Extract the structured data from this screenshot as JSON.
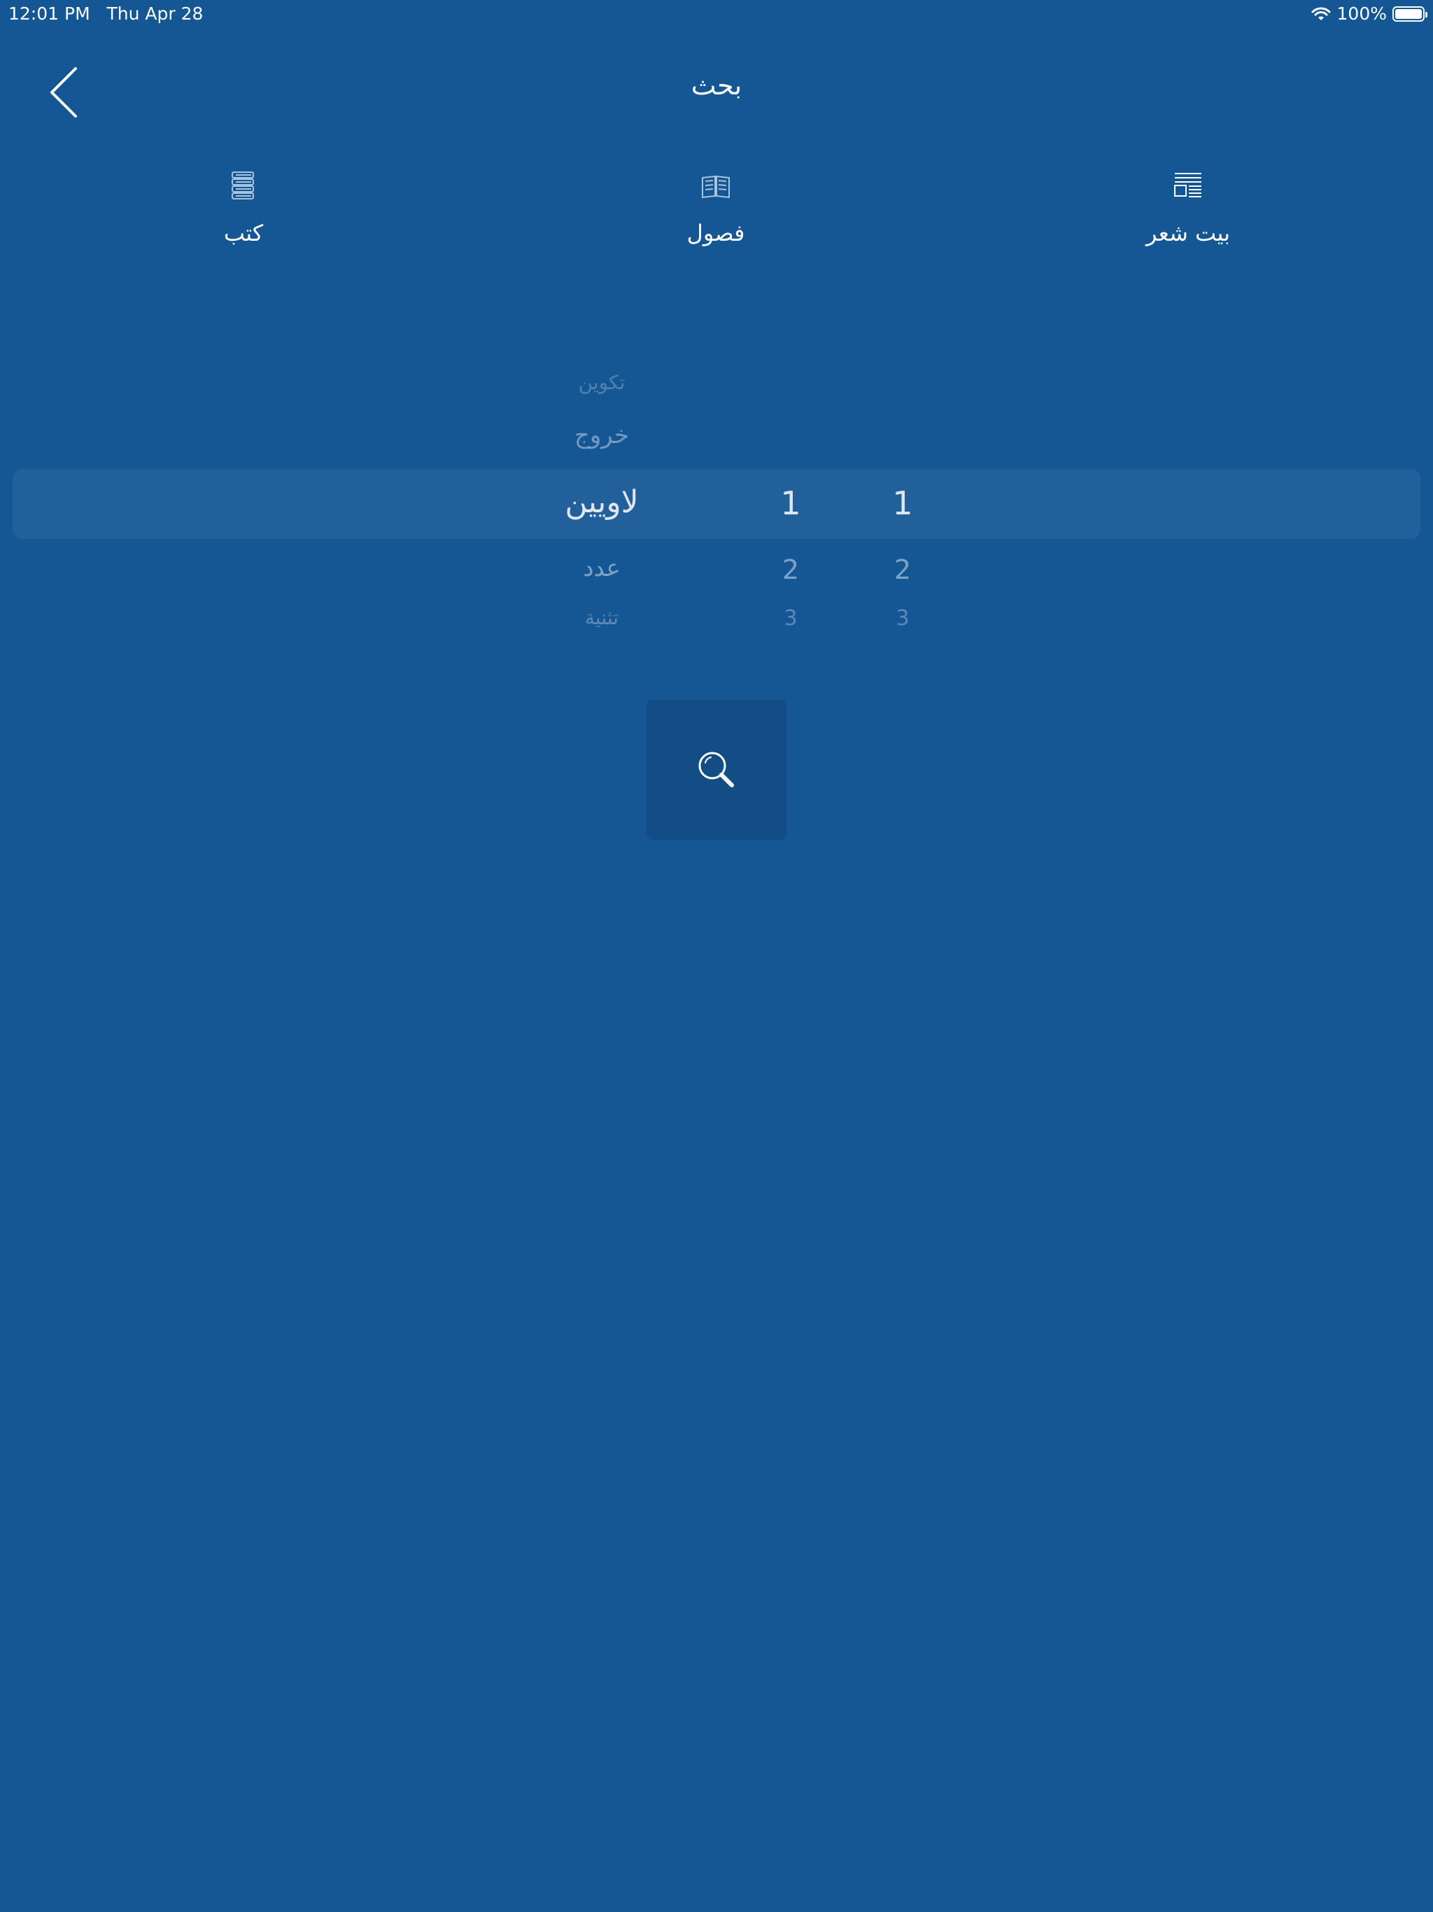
{
  "status_bar": {
    "time": "12:01 PM",
    "date": "Thu Apr 28",
    "battery_text": "100%",
    "battery_level": 1.0,
    "wifi_icon": "wifi-icon"
  },
  "nav": {
    "title": "بحث",
    "back_icon": "chevron-left-icon"
  },
  "tabs": [
    {
      "label": "كتب",
      "icon": "books-stack-icon"
    },
    {
      "label": "فصول",
      "icon": "open-book-icon"
    },
    {
      "label": "بيت شعر",
      "icon": "article-icon"
    }
  ],
  "picker": {
    "books": [
      "تكوين",
      "خروج",
      "لاويين",
      "عدد",
      "تثنية"
    ],
    "chapters": [
      "1",
      "2",
      "3"
    ],
    "verses": [
      "1",
      "2",
      "3"
    ],
    "selected_book": "لاويين",
    "selected_chapter": "1",
    "selected_verse": "1"
  },
  "search_button": {
    "icon": "search-icon"
  },
  "colors": {
    "background": "#155795",
    "button": "#124d86",
    "text": "#ffffff"
  }
}
